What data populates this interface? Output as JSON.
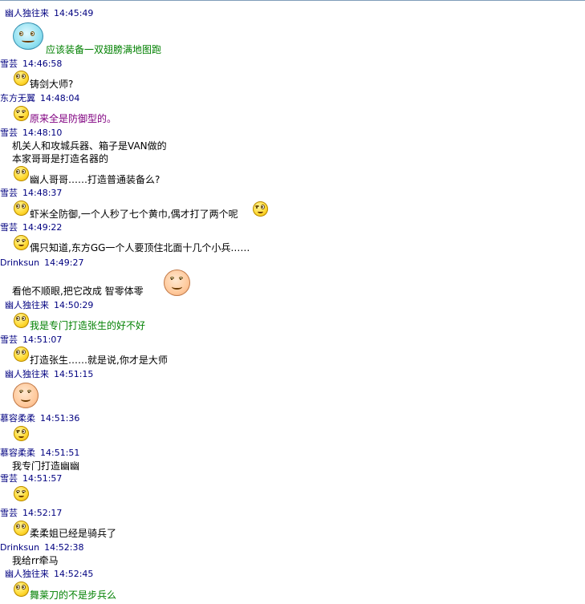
{
  "messages": [
    {
      "name": "幽人独往来",
      "time": "14:45:49",
      "text": "应该装备一双翅膀满地图跑",
      "color": "green"
    },
    {
      "name": "雪芸",
      "time": "14:46:58",
      "text": "铸剑大师?",
      "color": "black"
    },
    {
      "name": "东方无翼",
      "time": "14:48:04",
      "text": "原来全是防御型的。",
      "color": "purple"
    },
    {
      "name": "雪芸",
      "time": "14:48:10",
      "lines": [
        "机关人和攻城兵器、箱子是VAN做的",
        "本家哥哥是打造名器的"
      ],
      "text": "幽人哥哥……打造普通装备么?",
      "color": "black"
    },
    {
      "name": "雪芸",
      "time": "14:48:37",
      "text": "虾米全防御,一个人秒了七个黄巾,偶才打了两个呢",
      "color": "black"
    },
    {
      "name": "雪芸",
      "time": "14:49:22",
      "text": "偶只知道,东方GG一个人要顶住北面十几个小兵……",
      "color": "black"
    },
    {
      "name": "Drinksun",
      "time": "14:49:27",
      "text": "看他不顺眼,把它改成 智零体零",
      "color": "black"
    },
    {
      "name": "幽人独往来",
      "time": "14:50:29",
      "text": "我是专门打造张生的好不好",
      "color": "green"
    },
    {
      "name": "雪芸",
      "time": "14:51:07",
      "text": "打造张生……就是说,你才是大师",
      "color": "black"
    },
    {
      "name": "幽人独往来",
      "time": "14:51:15"
    },
    {
      "name": "慕容柔柔",
      "time": "14:51:36"
    },
    {
      "name": "慕容柔柔",
      "time": "14:51:51",
      "text": "我专门打造幽幽",
      "color": "black"
    },
    {
      "name": "雪芸",
      "time": "14:51:57"
    },
    {
      "name": "雪芸",
      "time": "14:52:17",
      "text": "柔柔姐已经是骑兵了",
      "color": "black"
    },
    {
      "name": "Drinksun",
      "time": "14:52:38",
      "text": "我给rr牵马",
      "color": "black"
    },
    {
      "name": "幽人独往来",
      "time": "14:52:45",
      "text": "舞莱刀的不是步兵么",
      "color": "green"
    }
  ],
  "icons": {
    "smiley": "smiley-icon",
    "big_grin": "grin-icon",
    "blue_face": "blue-face-icon"
  }
}
